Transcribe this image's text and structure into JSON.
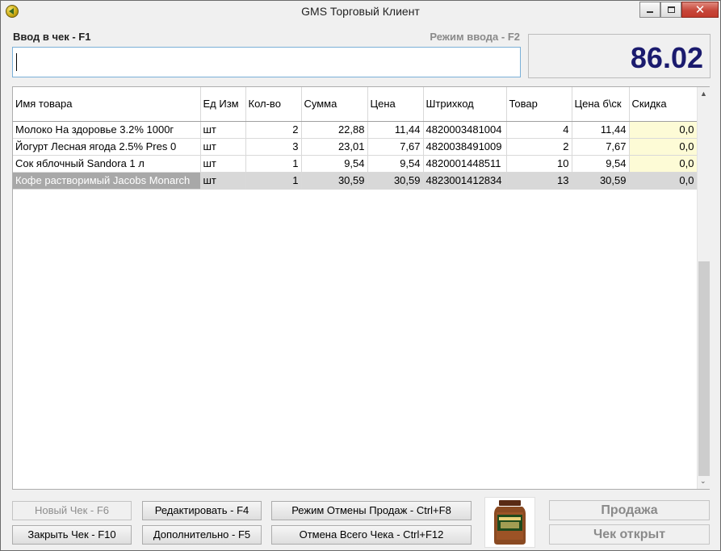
{
  "window": {
    "title": "GMS Торговый Клиент",
    "close_glyph": "✕"
  },
  "entry": {
    "label": "Ввод в чек - F1",
    "mode_label": "Режим ввода - F2",
    "value": ""
  },
  "total": "86.02",
  "table": {
    "columns": [
      "Имя товара",
      "Ед Изм",
      "Кол-во",
      "Сумма",
      "Цена",
      "Штрихкод",
      "Товар",
      "Цена б\\ск",
      "Скидка"
    ],
    "rows": [
      [
        "Молоко На здоровье 3.2% 1000г",
        "шт",
        "2",
        "22,88",
        "11,44",
        "4820003481004",
        "4",
        "11,44",
        "0,0"
      ],
      [
        "Йогурт Лесная ягода 2.5% Pres 0",
        "шт",
        "3",
        "23,01",
        "7,67",
        "4820038491009",
        "2",
        "7,67",
        "0,0"
      ],
      [
        "Сок яблочный Sandora 1 л",
        "шт",
        "1",
        "9,54",
        "9,54",
        "4820001448511",
        "10",
        "9,54",
        "0,0"
      ],
      [
        "Кофе растворимый Jacobs Monarch",
        "шт",
        "1",
        "30,59",
        "30,59",
        "4823001412834",
        "13",
        "30,59",
        "0,0"
      ]
    ],
    "selected_row": 3
  },
  "buttons": {
    "new_check": "Новый Чек - F6",
    "close_check": "Закрыть Чек - F10",
    "edit": "Редактировать - F4",
    "additional": "Дополнительно - F5",
    "cancel_sales_mode": "Режим Отмены Продаж - Ctrl+F8",
    "cancel_whole_check": "Отмена Всего Чека - Ctrl+F12"
  },
  "status": {
    "sale": "Продажа",
    "check_open": "Чек открыт"
  },
  "product_image": {
    "label": "Jacobs"
  },
  "colors": {
    "total": "#1b1b6e",
    "discount_bg": "#fdfbd6",
    "selected_bg": "#d8d8d8"
  }
}
